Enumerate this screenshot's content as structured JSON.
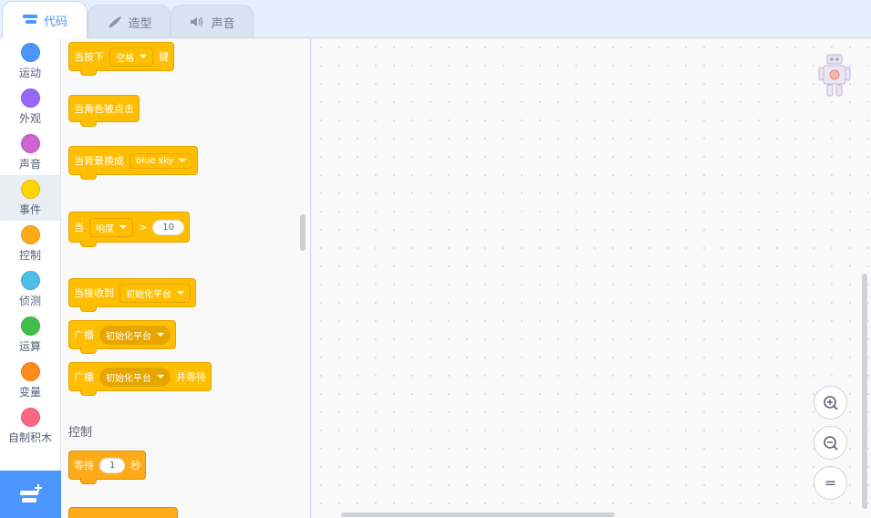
{
  "tabs": [
    {
      "label": "代码",
      "icon": "code-icon",
      "active": true
    },
    {
      "label": "造型",
      "icon": "brush-icon",
      "active": false
    },
    {
      "label": "声音",
      "icon": "speaker-icon",
      "active": false
    }
  ],
  "categories": [
    {
      "label": "运动",
      "color": "#4c97ff"
    },
    {
      "label": "外观",
      "color": "#9966ff"
    },
    {
      "label": "声音",
      "color": "#cf63cf"
    },
    {
      "label": "事件",
      "color": "#ffd500"
    },
    {
      "label": "控制",
      "color": "#ffab19"
    },
    {
      "label": "侦测",
      "color": "#4cbfe6"
    },
    {
      "label": "运算",
      "color": "#40bf4a"
    },
    {
      "label": "变量",
      "color": "#ff8c1a"
    },
    {
      "label": "自制积木",
      "color": "#ff6680"
    }
  ],
  "selected_category": "事件",
  "blocks": {
    "key_pressed": {
      "pre": "当按下",
      "key": "空格",
      "post": "键"
    },
    "sprite_clicked": {
      "text": "当角色被点击"
    },
    "backdrop_switch": {
      "pre": "当背景换成",
      "backdrop": "blue sky"
    },
    "when_greater": {
      "pre": "当",
      "sensor": "响度",
      "op": ">",
      "value": "10"
    },
    "when_receive": {
      "pre": "当接收到",
      "message": "初始化平台"
    },
    "broadcast": {
      "pre": "广播",
      "message": "初始化平台"
    },
    "broadcast_wait": {
      "pre": "广播",
      "message": "初始化平台",
      "post": "并等待"
    }
  },
  "control_section": {
    "title": "控制",
    "wait": {
      "pre": "等待",
      "value": "1",
      "post": "秒"
    }
  },
  "zoom": {
    "in": "zoom-in-icon",
    "out": "zoom-out-icon",
    "reset": "="
  }
}
